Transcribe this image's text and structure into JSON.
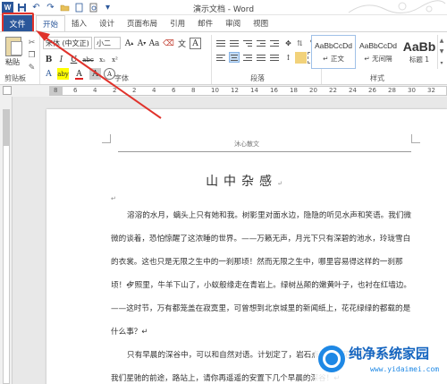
{
  "window": {
    "title": "演示文档 - Word"
  },
  "tabs": {
    "file": "文件",
    "items": [
      "开始",
      "插入",
      "设计",
      "页面布局",
      "引用",
      "邮件",
      "审阅",
      "视图"
    ],
    "active_index": 0
  },
  "ribbon": {
    "clipboard": {
      "paste_label": "粘贴",
      "group_label": "剪贴板"
    },
    "font": {
      "font_name": "宋体 (中文正)",
      "font_size": "小二",
      "group_label": "字体",
      "buttons": [
        "B",
        "I",
        "U",
        "abc",
        "x₂",
        "x²",
        "A",
        "aby",
        "A",
        "Aa",
        "A"
      ]
    },
    "paragraph": {
      "group_label": "段落"
    },
    "styles": {
      "group_label": "样式",
      "items": [
        {
          "sample": "AaBbCcDd",
          "name": "↵ 正文"
        },
        {
          "sample": "AaBbCcDd",
          "name": "↵ 无间隔"
        },
        {
          "sample": "AaBb",
          "name": "标题 1"
        }
      ]
    }
  },
  "ruler": {
    "numbers": [
      "8",
      "6",
      "4",
      "2",
      "2",
      "4",
      "6",
      "8",
      "10",
      "12",
      "14",
      "16",
      "18",
      "20",
      "22",
      "24",
      "26",
      "28",
      "30",
      "32"
    ]
  },
  "document": {
    "header": "沐心散文",
    "title": "山中杂感",
    "paragraphs": [
      "溶溶的水月，螭头上只有她和我。树影里对面水边，隐隐的听见水声和笑语。我们微微的谈着，恐怕惊醒了这浓睡的世界。——万籁无声，月光下只有深碧的池水，玲珑雪白的衣裳。这也只是无限之生中的一刹那顷！然而无限之生中，哪里容易得这样的一刹那顷！↵",
      "夕照里，牛羊下山了，小蚁般缘走在青岩上。绿树丛颠的嫩黄叶子，也衬在红墙边。——这时节，万有都笼盖在寂寞里，可曾想到北京城里的新闻纸上，花花绿绿的都载的是什么事？↵",
      "只有早晨的深谷中，可以和自然对语。计划定了，岩石点头，草花欢笑。造物者呵！我们星驰的前途，路站上，请你再遥遥的安置下几个早晨的深谷！↵"
    ]
  },
  "watermark": {
    "text": "纯净系统家园",
    "url": "www.yidaimei.com"
  },
  "colors": {
    "word_blue": "#2b579a",
    "highlight_red": "#e0322b",
    "font_color_red": "#e02020",
    "highlight_yellow": "#ffff00"
  }
}
